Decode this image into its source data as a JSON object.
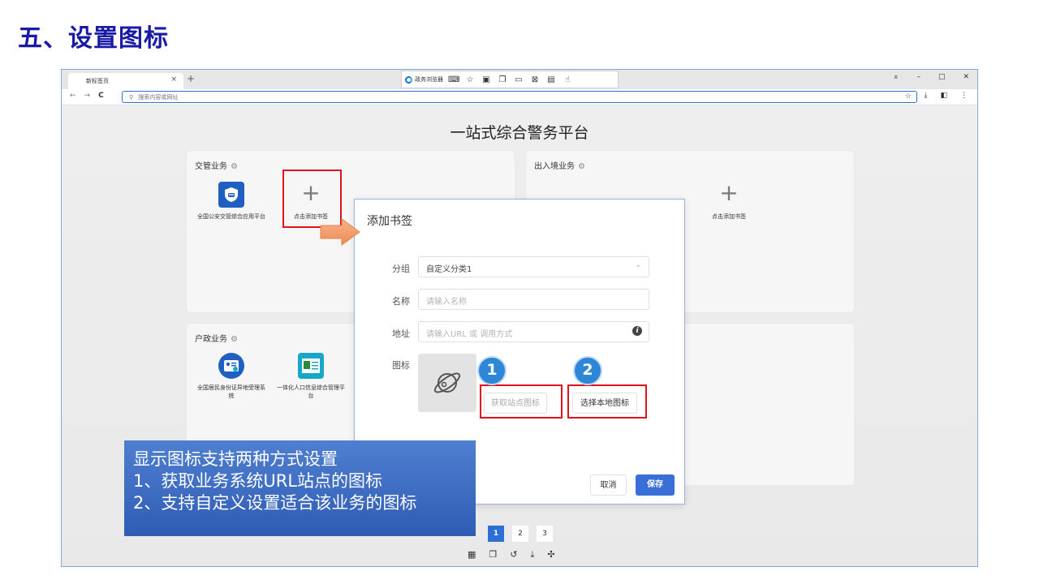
{
  "slide": {
    "title": "五、设置图标"
  },
  "browser": {
    "tab_label": "新标签页",
    "tab_close": "×",
    "tab_add": "+",
    "ext_brand": "政务浏览器",
    "ext_icons": [
      "keyboard-icon",
      "star-icon",
      "screenshot-icon",
      "copy-icon",
      "screen-icon",
      "crop-icon",
      "cast-icon",
      "hand-icon"
    ],
    "window_controls": [
      "pin-icon",
      "minimize-icon",
      "maximize-icon",
      "close-icon"
    ],
    "url_placeholder": "搜索内容或网址"
  },
  "page": {
    "title": "一站式综合警务平台",
    "cards": [
      {
        "title": "交管业务",
        "apps": [
          {
            "label": "全国公安交管综合应用平台",
            "icon": "shield-car-icon",
            "color": "#1f5fc2"
          },
          {
            "label": "点击添加书签",
            "icon": "plus-icon"
          }
        ]
      },
      {
        "title": "出入境业务",
        "apps": [
          {
            "label": "点击添加书签",
            "icon": "plus-icon"
          }
        ]
      },
      {
        "title": "户政业务",
        "apps": [
          {
            "label": "全国居民身份证异地受理系统",
            "icon": "id-card-icon",
            "color": "#1f5fc2"
          },
          {
            "label": "一体化人口信息综合管理平台",
            "icon": "id-badge-icon",
            "color": "#16a7c9"
          }
        ]
      }
    ],
    "pagination": [
      "1",
      "2",
      "3"
    ],
    "pagination_active": "1",
    "bottom_tools": [
      "collection-icon",
      "copy-icon",
      "history-icon",
      "download-icon",
      "extension-icon"
    ]
  },
  "dialog": {
    "title": "添加书签",
    "group_label": "分组",
    "group_value": "自定义分类1",
    "name_label": "名称",
    "name_placeholder": "请输入名称",
    "address_label": "地址",
    "address_placeholder": "请输入URL 或 调用方式",
    "icon_label": "图标",
    "fetch_icon_button": "获取站点图标",
    "local_icon_button": "选择本地图标",
    "cancel_button": "取消",
    "save_button": "保存"
  },
  "annotations": {
    "badge1": "1",
    "badge2": "2",
    "callout_lines": [
      "显示图标支持两种方式设置",
      "1、获取业务系统URL站点的图标",
      "2、支持自定义设置适合该业务的图标"
    ],
    "highlight_color": "#e0131c"
  }
}
